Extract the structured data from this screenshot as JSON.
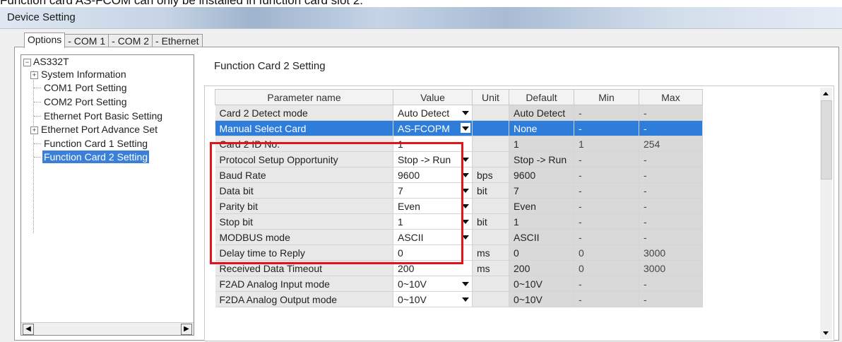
{
  "caption": "Function card AS-FCOM can only be installed in function card slot 2.",
  "window": {
    "title": "Device Setting"
  },
  "tabs": [
    "Options",
    "- COM 1",
    "- COM 2",
    "- Ethernet"
  ],
  "tree": {
    "root": "AS332T",
    "items": [
      "System Information",
      "COM1 Port Setting",
      "COM2 Port Setting",
      "Ethernet Port Basic Setting",
      "Ethernet Port Advance Set",
      "Function Card 1 Setting",
      "Function Card 2 Setting"
    ],
    "selected": "Function Card 2 Setting"
  },
  "section_title": "Function Card 2 Setting",
  "table": {
    "headers": [
      "Parameter name",
      "Value",
      "Unit",
      "Default",
      "Min",
      "Max"
    ],
    "rows": [
      {
        "name": "Card 2 Detect mode",
        "value": "Auto Detect",
        "unit": "",
        "default": "Auto Detect",
        "min": "-",
        "max": "-"
      },
      {
        "name": "Manual Select Card",
        "value": "AS-FCOPM",
        "unit": "",
        "default": "None",
        "min": "-",
        "max": "-"
      },
      {
        "name": "Card 2 ID No.",
        "value": "1",
        "unit": "",
        "default": "1",
        "min": "1",
        "max": "254"
      },
      {
        "name": "Protocol Setup Opportunity",
        "value": "Stop -> Run",
        "unit": "",
        "default": "Stop -> Run",
        "min": "-",
        "max": "-"
      },
      {
        "name": "Baud Rate",
        "value": "9600",
        "unit": "bps",
        "default": "9600",
        "min": "-",
        "max": "-"
      },
      {
        "name": "Data bit",
        "value": "7",
        "unit": "bit",
        "default": "7",
        "min": "-",
        "max": "-"
      },
      {
        "name": "Parity bit",
        "value": "Even",
        "unit": "",
        "default": "Even",
        "min": "-",
        "max": "-"
      },
      {
        "name": "Stop bit",
        "value": "1",
        "unit": "bit",
        "default": "1",
        "min": "-",
        "max": "-"
      },
      {
        "name": "MODBUS mode",
        "value": "ASCII",
        "unit": "",
        "default": "ASCII",
        "min": "-",
        "max": "-"
      },
      {
        "name": "Delay time to Reply",
        "value": "0",
        "unit": "ms",
        "default": "0",
        "min": "0",
        "max": "3000"
      },
      {
        "name": "Received Data Timeout",
        "value": "200",
        "unit": "ms",
        "default": "200",
        "min": "0",
        "max": "3000"
      },
      {
        "name": "F2AD Analog Input mode",
        "value": "0~10V",
        "unit": "",
        "default": "0~10V",
        "min": "-",
        "max": "-"
      },
      {
        "name": "F2DA Analog Output mode",
        "value": "0~10V",
        "unit": "",
        "default": "0~10V",
        "min": "-",
        "max": "-"
      }
    ],
    "highlight_color": "#2f7ddb",
    "annotation_color": "#e0151c"
  }
}
